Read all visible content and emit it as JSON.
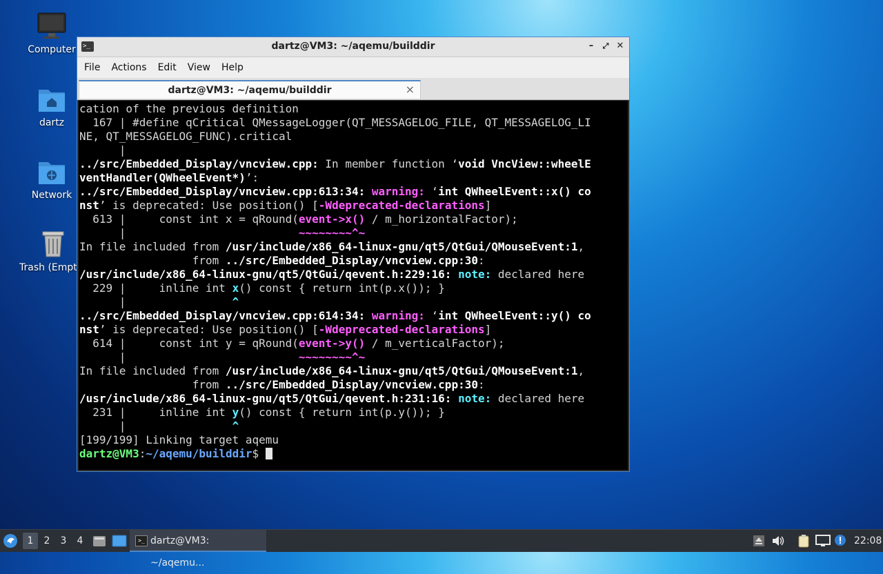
{
  "desktop": {
    "icons": [
      {
        "label": "Computer",
        "icon": "monitor-icon"
      },
      {
        "label": "dartz",
        "icon": "home-folder-icon"
      },
      {
        "label": "Network",
        "icon": "network-folder-icon"
      },
      {
        "label": "Trash (Empty)",
        "icon": "trash-icon"
      }
    ]
  },
  "window": {
    "title": "dartz@VM3: ~/aqemu/builddir",
    "menu": [
      "File",
      "Actions",
      "Edit",
      "View",
      "Help"
    ],
    "tab_label": "dartz@VM3: ~/aqemu/builddir",
    "tab_close": "×",
    "btn_min": "–",
    "btn_max": "⤢",
    "btn_close": "✕"
  },
  "terminal": {
    "lines": [
      [
        {
          "t": "cation of the previous definition",
          "s": ""
        }
      ],
      [
        {
          "t": "  167 | #define qCritical QMessageLogger(QT_MESSAGELOG_FILE, QT_MESSAGELOG_LI",
          "s": ""
        }
      ],
      [
        {
          "t": "NE, QT_MESSAGELOG_FUNC).critical",
          "s": ""
        }
      ],
      [
        {
          "t": "      |",
          "s": ""
        }
      ],
      [
        {
          "t": "../src/Embedded_Display/vncview.cpp:",
          "s": "b"
        },
        {
          "t": " In member function ‘",
          "s": ""
        },
        {
          "t": "void VncView::wheelE",
          "s": "b"
        }
      ],
      [
        {
          "t": "ventHandler(QWheelEvent*)",
          "s": "b"
        },
        {
          "t": "’:",
          "s": ""
        }
      ],
      [
        {
          "t": "../src/Embedded_Display/vncview.cpp:613:34:",
          "s": "b"
        },
        {
          "t": " ",
          "s": ""
        },
        {
          "t": "warning:",
          "s": "m"
        },
        {
          "t": " ‘",
          "s": ""
        },
        {
          "t": "int QWheelEvent::x() co",
          "s": "b"
        }
      ],
      [
        {
          "t": "nst",
          "s": "b"
        },
        {
          "t": "’ is deprecated: Use position() [",
          "s": ""
        },
        {
          "t": "-Wdeprecated-declarations",
          "s": "m"
        },
        {
          "t": "]",
          "s": ""
        }
      ],
      [
        {
          "t": "  613 |     const int x = qRound(",
          "s": ""
        },
        {
          "t": "event->x()",
          "s": "m"
        },
        {
          "t": " / m_horizontalFactor);",
          "s": ""
        }
      ],
      [
        {
          "t": "      |                          ",
          "s": ""
        },
        {
          "t": "~~~~~~~~^~",
          "s": "m"
        }
      ],
      [
        {
          "t": "In file included from ",
          "s": ""
        },
        {
          "t": "/usr/include/x86_64-linux-gnu/qt5/QtGui/QMouseEvent:1",
          "s": "b"
        },
        {
          "t": ",",
          "s": ""
        }
      ],
      [
        {
          "t": "                 from ",
          "s": ""
        },
        {
          "t": "../src/Embedded_Display/vncview.cpp:30",
          "s": "b"
        },
        {
          "t": ":",
          "s": ""
        }
      ],
      [
        {
          "t": "/usr/include/x86_64-linux-gnu/qt5/QtGui/qevent.h:229:16:",
          "s": "b"
        },
        {
          "t": " ",
          "s": ""
        },
        {
          "t": "note:",
          "s": "c"
        },
        {
          "t": " declared here",
          "s": ""
        }
      ],
      [
        {
          "t": "  229 |     inline int ",
          "s": ""
        },
        {
          "t": "x",
          "s": "c"
        },
        {
          "t": "() const { return int(p.x()); }",
          "s": ""
        }
      ],
      [
        {
          "t": "      |                ",
          "s": ""
        },
        {
          "t": "^",
          "s": "c"
        }
      ],
      [
        {
          "t": "../src/Embedded_Display/vncview.cpp:614:34:",
          "s": "b"
        },
        {
          "t": " ",
          "s": ""
        },
        {
          "t": "warning:",
          "s": "m"
        },
        {
          "t": " ‘",
          "s": ""
        },
        {
          "t": "int QWheelEvent::y() co",
          "s": "b"
        }
      ],
      [
        {
          "t": "nst",
          "s": "b"
        },
        {
          "t": "’ is deprecated: Use position() [",
          "s": ""
        },
        {
          "t": "-Wdeprecated-declarations",
          "s": "m"
        },
        {
          "t": "]",
          "s": ""
        }
      ],
      [
        {
          "t": "  614 |     const int y = qRound(",
          "s": ""
        },
        {
          "t": "event->y()",
          "s": "m"
        },
        {
          "t": " / m_verticalFactor);",
          "s": ""
        }
      ],
      [
        {
          "t": "      |                          ",
          "s": ""
        },
        {
          "t": "~~~~~~~~^~",
          "s": "m"
        }
      ],
      [
        {
          "t": "In file included from ",
          "s": ""
        },
        {
          "t": "/usr/include/x86_64-linux-gnu/qt5/QtGui/QMouseEvent:1",
          "s": "b"
        },
        {
          "t": ",",
          "s": ""
        }
      ],
      [
        {
          "t": "                 from ",
          "s": ""
        },
        {
          "t": "../src/Embedded_Display/vncview.cpp:30",
          "s": "b"
        },
        {
          "t": ":",
          "s": ""
        }
      ],
      [
        {
          "t": "/usr/include/x86_64-linux-gnu/qt5/QtGui/qevent.h:231:16:",
          "s": "b"
        },
        {
          "t": " ",
          "s": ""
        },
        {
          "t": "note:",
          "s": "c"
        },
        {
          "t": " declared here",
          "s": ""
        }
      ],
      [
        {
          "t": "  231 |     inline int ",
          "s": ""
        },
        {
          "t": "y",
          "s": "c"
        },
        {
          "t": "() const { return int(p.y()); }",
          "s": ""
        }
      ],
      [
        {
          "t": "      |                ",
          "s": ""
        },
        {
          "t": "^",
          "s": "c"
        }
      ],
      [
        {
          "t": "[199/199] Linking target aqemu",
          "s": ""
        }
      ]
    ],
    "prompt_user": "dartz@VM3",
    "prompt_sep": ":",
    "prompt_path": "~/aqemu/builddir",
    "prompt_sym": "$ "
  },
  "taskbar": {
    "workspaces": [
      "1",
      "2",
      "3",
      "4"
    ],
    "active_workspace": "1",
    "task_label": "dartz@VM3: ~/aqemu...",
    "clock": "22:08"
  },
  "colors": {
    "accent": "#4f87c6",
    "warning": "#ff5fff",
    "note": "#5ff0ff",
    "prompt_user": "#6bff7b",
    "prompt_path": "#6aa8ff"
  }
}
